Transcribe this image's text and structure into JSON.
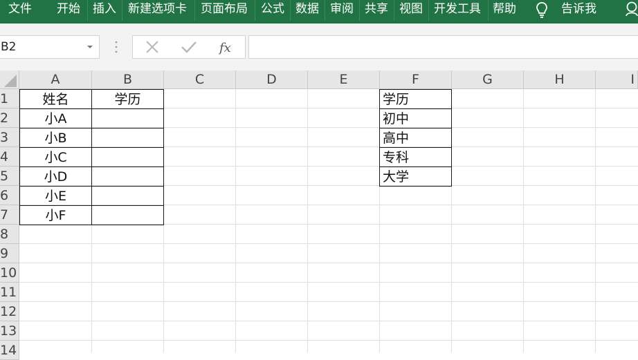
{
  "ribbon": {
    "tabs": [
      "文件",
      "开始",
      "插入",
      "新建选项卡",
      "页面布局",
      "公式",
      "数据",
      "审阅",
      "共享",
      "视图",
      "开发工具",
      "帮助"
    ],
    "tell_me": "告诉我"
  },
  "formula_bar": {
    "name_box": "B2",
    "formula": ""
  },
  "columns": [
    "A",
    "B",
    "C",
    "D",
    "E",
    "F",
    "G",
    "H",
    "I"
  ],
  "rows": [
    "1",
    "2",
    "3",
    "4",
    "5",
    "6",
    "7",
    "8",
    "9",
    "10",
    "11",
    "12",
    "13",
    "14"
  ],
  "table_a_b": {
    "headers": {
      "A": "姓名",
      "B": "学历"
    },
    "names": [
      "小A",
      "小B",
      "小C",
      "小D",
      "小E",
      "小F"
    ]
  },
  "table_f": {
    "header": "学历",
    "items": [
      "初中",
      "高中",
      "专科",
      "大学"
    ]
  },
  "colors": {
    "ribbon": "#217346",
    "header_bg": "#e6e6e6",
    "gridline": "#e0e0e0"
  }
}
